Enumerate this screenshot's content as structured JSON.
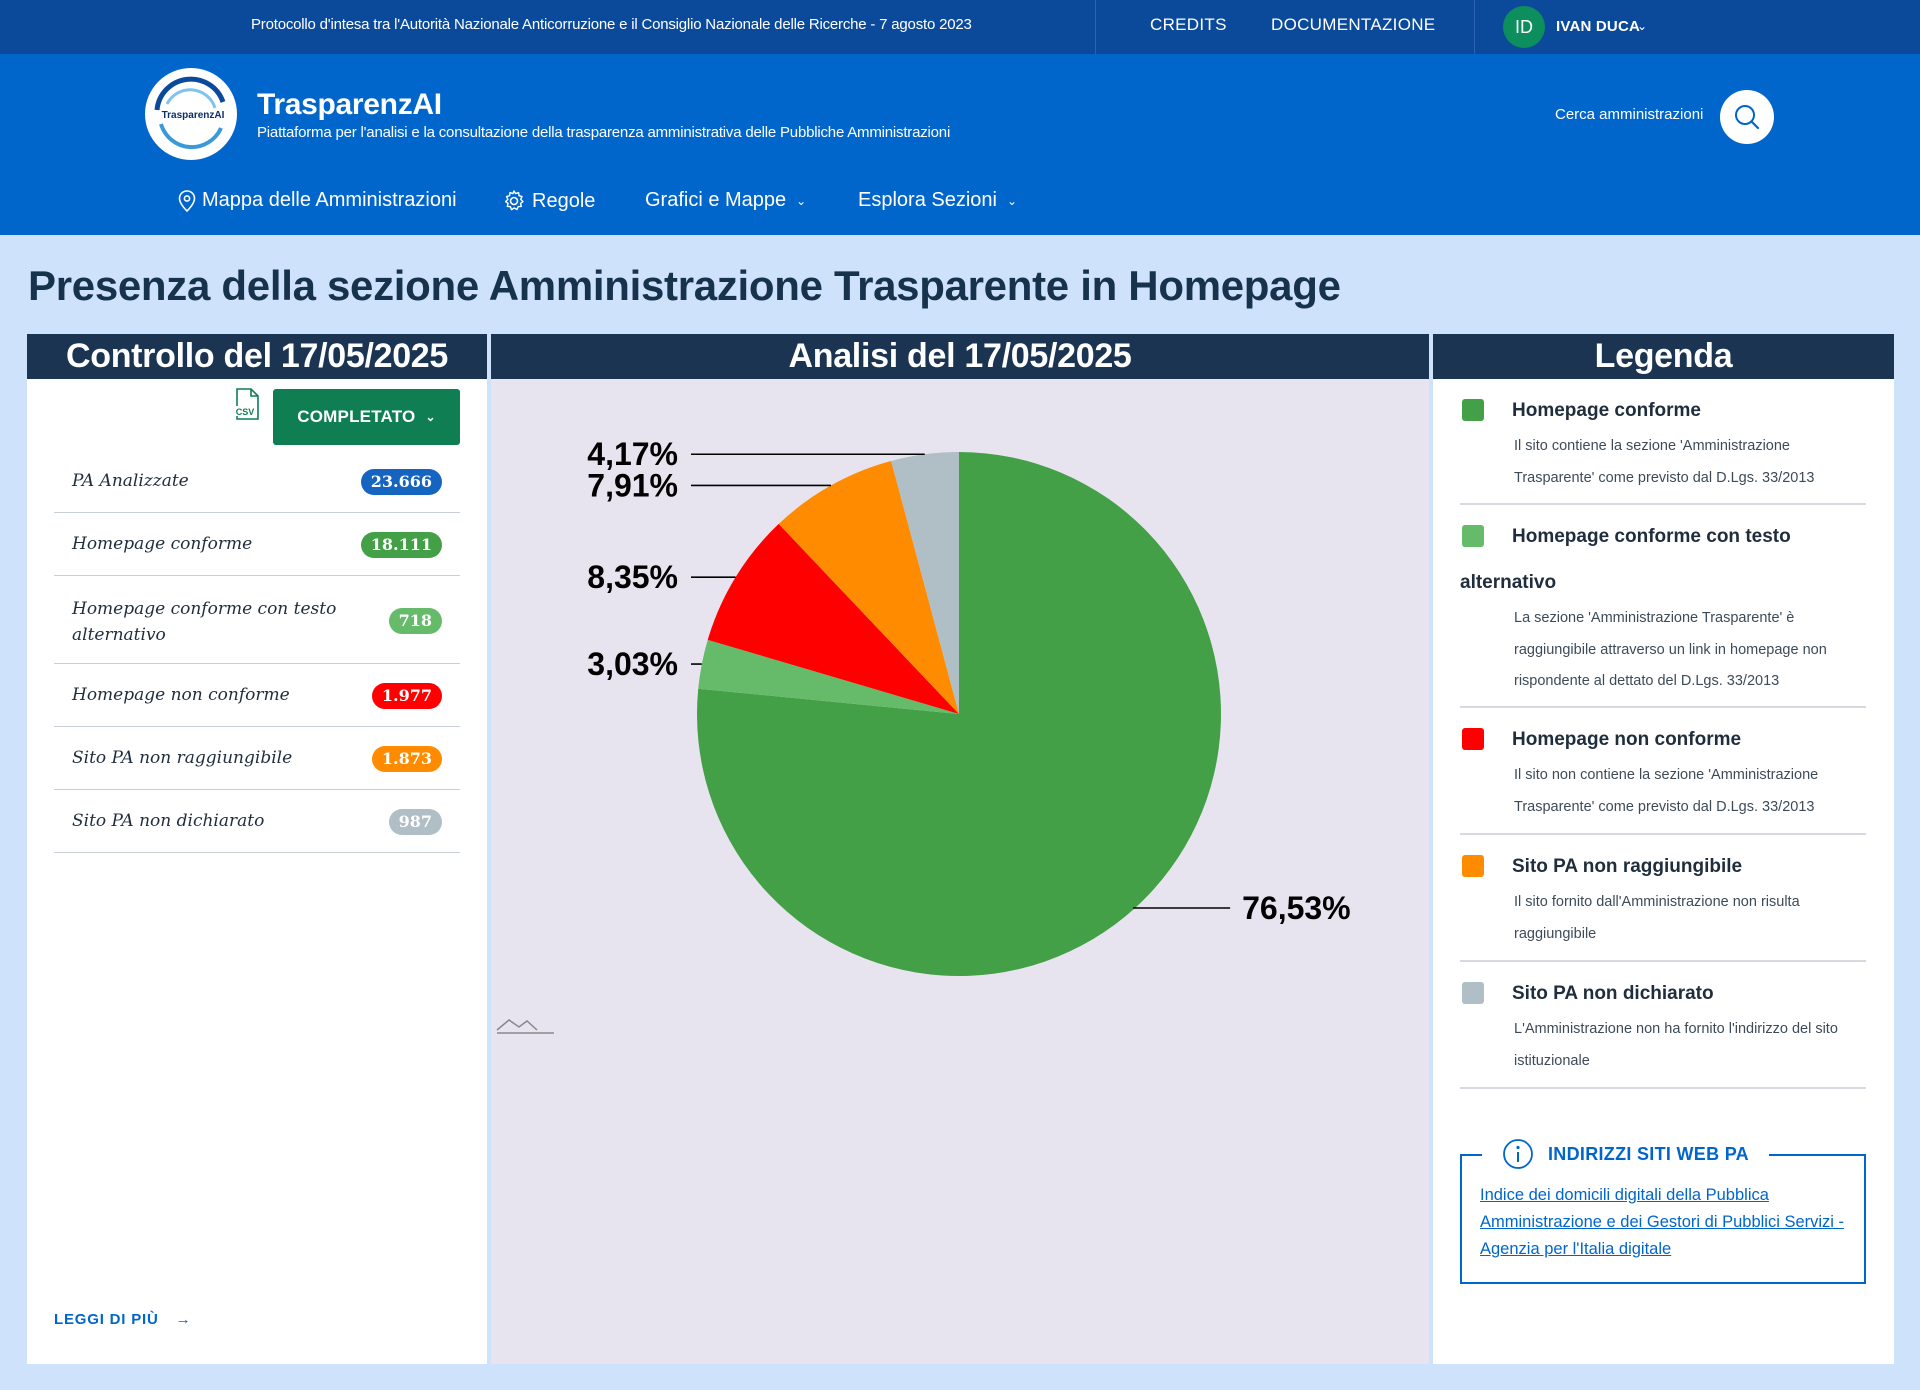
{
  "topbar": {
    "protocol": "Protocollo d'intesa tra l'Autorità Nazionale Anticorruzione e il Consiglio Nazionale delle Ricerche - 7 agosto 2023",
    "credits": "CREDITS",
    "docs": "DOCUMENTAZIONE",
    "avatar_initials": "ID",
    "user_name": "IVAN DUCA"
  },
  "header": {
    "logo_text": "TrasparenzAI",
    "title": "TrasparenzAI",
    "subtitle": "Piattaforma per l'analisi e la consultazione della trasparenza amministrativa delle Pubbliche Amministrazioni",
    "search_label": "Cerca amministrazioni"
  },
  "nav": {
    "map": "Mappa delle Amministrazioni",
    "rules": "Regole",
    "charts": "Grafici e Mappe",
    "explore": "Esplora Sezioni"
  },
  "page_title": "Presenza della sezione Amministrazione Trasparente in Homepage",
  "left": {
    "heading": "Controllo del 17/05/2025",
    "csv_label": "CSV",
    "status_button": "COMPLETATO",
    "stats": [
      {
        "label": "PA Analizzate",
        "value": "23.666",
        "color": "#1565c0"
      },
      {
        "label": "Homepage conforme",
        "value": "18.111",
        "color": "#43a047"
      },
      {
        "label": "Homepage conforme con testo alternativo",
        "value": "718",
        "color": "#66bb6a"
      },
      {
        "label": "Homepage non conforme",
        "value": "1.977",
        "color": "#ff0000"
      },
      {
        "label": "Sito PA non raggiungibile",
        "value": "1.873",
        "color": "#ff8c00"
      },
      {
        "label": "Sito PA non dichiarato",
        "value": "987",
        "color": "#b0bec5"
      }
    ],
    "read_more": "LEGGI DI PIÙ"
  },
  "middle": {
    "heading": "Analisi del 17/05/2025"
  },
  "chart_data": {
    "type": "pie",
    "title": "",
    "slices": [
      {
        "name": "Homepage conforme",
        "value": 76.53,
        "label": "76,53%",
        "color": "#43a047"
      },
      {
        "name": "Homepage conforme con testo alternativo",
        "value": 3.03,
        "label": "3,03%",
        "color": "#66bb6a"
      },
      {
        "name": "Homepage non conforme",
        "value": 8.35,
        "label": "8,35%",
        "color": "#ff0000"
      },
      {
        "name": "Sito PA non raggiungibile",
        "value": 7.91,
        "label": "7,91%",
        "color": "#ff8c00"
      },
      {
        "name": "Sito PA non dichiarato",
        "value": 4.17,
        "label": "4,17%",
        "color": "#b0bec5"
      }
    ]
  },
  "legend": {
    "heading": "Legenda",
    "items": [
      {
        "title": "Homepage conforme",
        "desc": "Il sito contiene la sezione 'Amministrazione Trasparente' come previsto dal D.Lgs. 33/2013",
        "color": "#43a047"
      },
      {
        "title": "Homepage conforme con testo",
        "title2": "alternativo",
        "desc": "La sezione 'Amministrazione Trasparente' è raggiungibile attraverso un link in homepage non rispondente al dettato del D.Lgs. 33/2013",
        "color": "#66bb6a"
      },
      {
        "title": "Homepage non conforme",
        "desc": "Il sito non contiene la sezione 'Amministrazione Trasparente' come previsto dal D.Lgs. 33/2013",
        "color": "#ff0000"
      },
      {
        "title": "Sito PA non raggiungibile",
        "desc": "Il sito fornito dall'Amministrazione non risulta raggiungibile",
        "color": "#ff8c00"
      },
      {
        "title": "Sito PA non dichiarato",
        "desc": "L'Amministrazione non ha fornito l'indirizzo del sito istituzionale",
        "color": "#b0bec5"
      }
    ],
    "info_title": "INDIRIZZI SITI WEB PA",
    "info_link": "Indice dei domicili digitali della Pubblica Amministrazione e dei Gestori di Pubblici Servizi - Agenzia per l'Italia digitale"
  }
}
